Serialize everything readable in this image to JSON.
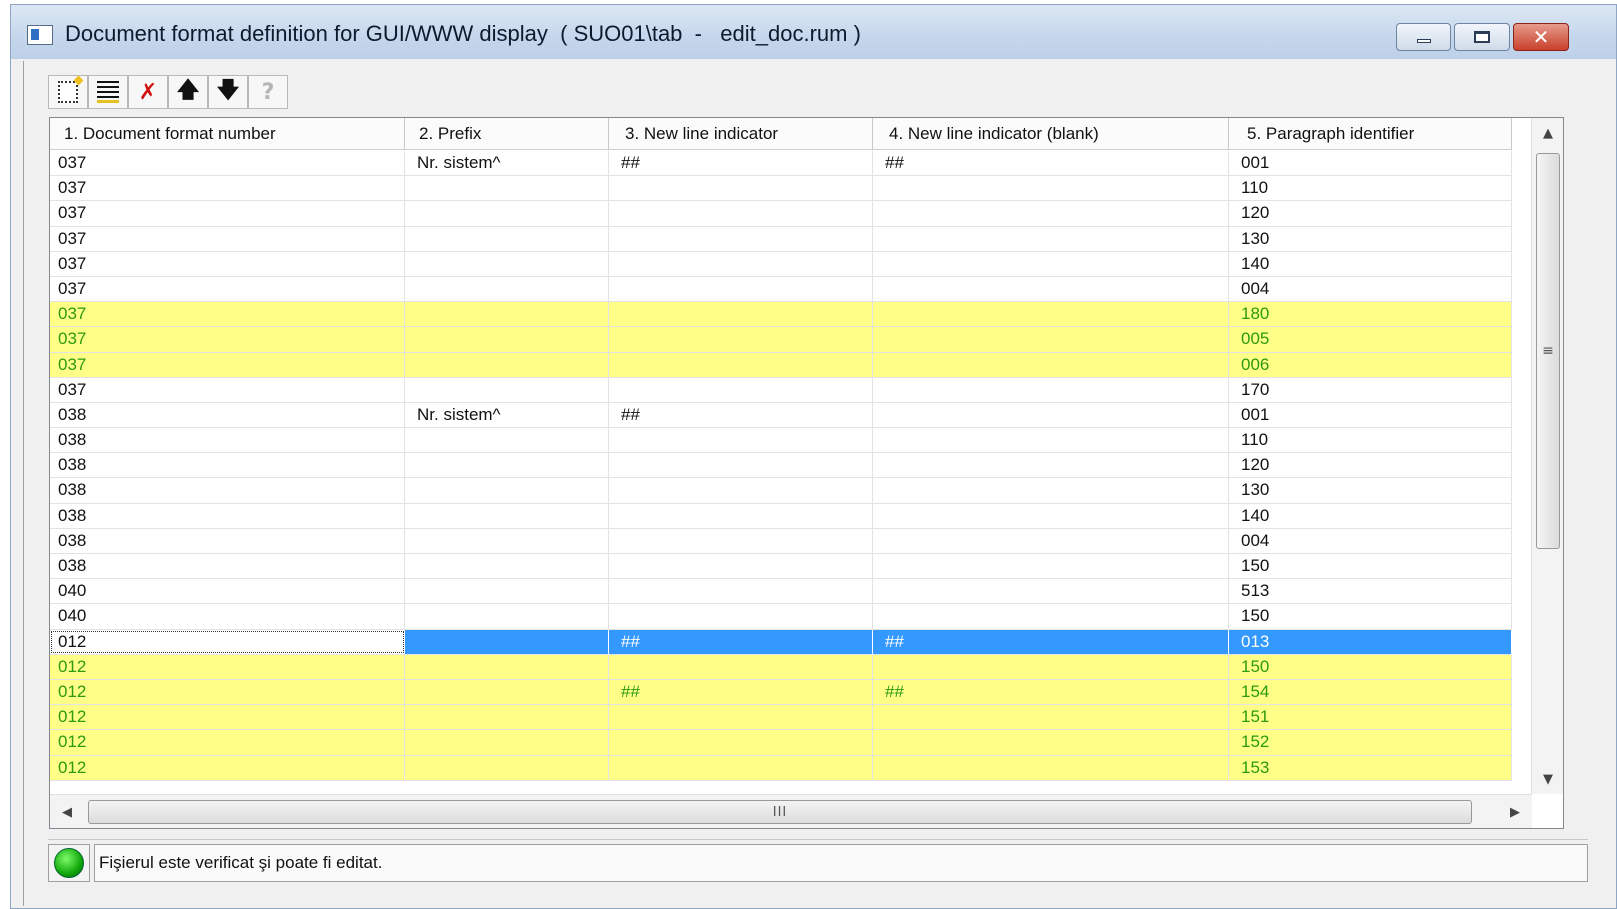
{
  "window": {
    "title": "Document format definition for GUI/WWW display  ( SUO01\\tab  -   edit_doc.rum )",
    "close_glyph": "✕"
  },
  "toolbar": {
    "delete_glyph": "✗",
    "up_glyph": "🡅",
    "down_glyph": "🡇",
    "help_glyph": "?"
  },
  "columns": [
    "1. Document format number",
    "2. Prefix",
    "3. New line indicator",
    "4. New line indicator (blank)",
    "5. Paragraph identifier"
  ],
  "rows": [
    {
      "c1": "037",
      "c2": "Nr. sistem^",
      "c3": "##",
      "c4": "##",
      "c5": "001",
      "state": "normal"
    },
    {
      "c1": "037",
      "c2": "",
      "c3": "",
      "c4": "",
      "c5": "110",
      "state": "normal"
    },
    {
      "c1": "037",
      "c2": "",
      "c3": "",
      "c4": "",
      "c5": "120",
      "state": "normal"
    },
    {
      "c1": "037",
      "c2": "",
      "c3": "",
      "c4": "",
      "c5": "130",
      "state": "normal"
    },
    {
      "c1": "037",
      "c2": "",
      "c3": "",
      "c4": "",
      "c5": "140",
      "state": "normal"
    },
    {
      "c1": "037",
      "c2": "",
      "c3": "",
      "c4": "",
      "c5": "004",
      "state": "normal"
    },
    {
      "c1": "037",
      "c2": "",
      "c3": "",
      "c4": "",
      "c5": "180",
      "state": "highlight"
    },
    {
      "c1": "037",
      "c2": "",
      "c3": "",
      "c4": "",
      "c5": "005",
      "state": "highlight"
    },
    {
      "c1": "037",
      "c2": "",
      "c3": "",
      "c4": "",
      "c5": "006",
      "state": "highlight"
    },
    {
      "c1": "037",
      "c2": "",
      "c3": "",
      "c4": "",
      "c5": "170",
      "state": "normal"
    },
    {
      "c1": "038",
      "c2": "Nr. sistem^",
      "c3": "##",
      "c4": "",
      "c5": "001",
      "state": "normal"
    },
    {
      "c1": "038",
      "c2": "",
      "c3": "",
      "c4": "",
      "c5": "110",
      "state": "normal"
    },
    {
      "c1": "038",
      "c2": "",
      "c3": "",
      "c4": "",
      "c5": "120",
      "state": "normal"
    },
    {
      "c1": "038",
      "c2": "",
      "c3": "",
      "c4": "",
      "c5": "130",
      "state": "normal"
    },
    {
      "c1": "038",
      "c2": "",
      "c3": "",
      "c4": "",
      "c5": "140",
      "state": "normal"
    },
    {
      "c1": "038",
      "c2": "",
      "c3": "",
      "c4": "",
      "c5": "004",
      "state": "normal"
    },
    {
      "c1": "038",
      "c2": "",
      "c3": "",
      "c4": "",
      "c5": "150",
      "state": "normal"
    },
    {
      "c1": "040",
      "c2": "",
      "c3": "",
      "c4": "",
      "c5": "513",
      "state": "normal"
    },
    {
      "c1": "040",
      "c2": "",
      "c3": "",
      "c4": "",
      "c5": "150",
      "state": "normal"
    },
    {
      "c1": "012",
      "c2": "",
      "c3": "##",
      "c4": "##",
      "c5": "013",
      "state": "selected"
    },
    {
      "c1": "012",
      "c2": "",
      "c3": "",
      "c4": "",
      "c5": "150",
      "state": "highlight"
    },
    {
      "c1": "012",
      "c2": "",
      "c3": "##",
      "c4": "##",
      "c5": "154",
      "state": "highlight"
    },
    {
      "c1": "012",
      "c2": "",
      "c3": "",
      "c4": "",
      "c5": "151",
      "state": "highlight"
    },
    {
      "c1": "012",
      "c2": "",
      "c3": "",
      "c4": "",
      "c5": "152",
      "state": "highlight"
    },
    {
      "c1": "012",
      "c2": "",
      "c3": "",
      "c4": "",
      "c5": "153",
      "state": "highlight"
    }
  ],
  "scrollbars": {
    "up_glyph": "▲",
    "down_glyph": "▼",
    "left_glyph": "◀",
    "right_glyph": "▶",
    "v_grip": "≡",
    "h_grip": "III"
  },
  "status": {
    "message": "Fişierul este verificat şi poate fi editat.",
    "led_color": "#12a80a"
  },
  "colors": {
    "highlight_row": "#ffff88",
    "highlight_text": "#2d9a10",
    "selection": "#3399ff"
  }
}
